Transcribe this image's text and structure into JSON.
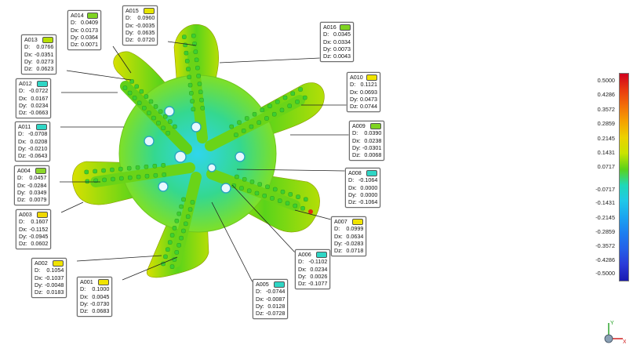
{
  "viewer": {
    "background": "#ffffff"
  },
  "callouts": [
    {
      "id": "A014",
      "swatch": "#7ed321",
      "D": "0.0409",
      "Dx": "0.0173",
      "Dy": "0.0364",
      "Dz": "0.0071"
    },
    {
      "id": "A015",
      "swatch": "#e5e500",
      "D": "0.0960",
      "Dx": "-0.0035",
      "Dy": "0.0635",
      "Dz": "0.0720"
    },
    {
      "id": "A016",
      "swatch": "#7ed321",
      "D": "0.0345",
      "Dx": "0.0334",
      "Dy": "0.0073",
      "Dz": "0.0043"
    },
    {
      "id": "A013",
      "swatch": "#b7e000",
      "D": "0.0766",
      "Dx": "-0.0351",
      "Dy": "0.0273",
      "Dz": "0.0623"
    },
    {
      "id": "A012",
      "swatch": "#2fd6c5",
      "D": "-0.0722",
      "Dx": "0.0167",
      "Dy": "0.0234",
      "Dz": "-0.0663"
    },
    {
      "id": "A010",
      "swatch": "#f0e400",
      "D": "0.1121",
      "Dx": "0.0693",
      "Dy": "0.0473",
      "Dz": "0.0744"
    },
    {
      "id": "A011",
      "swatch": "#2fd6c5",
      "D": "-0.0708",
      "Dx": "0.0208",
      "Dy": "-0.0210",
      "Dz": "-0.0643"
    },
    {
      "id": "A009",
      "swatch": "#7ed321",
      "D": "0.0390",
      "Dx": "0.0238",
      "Dy": "-0.0301",
      "Dz": "0.0068"
    },
    {
      "id": "A004",
      "swatch": "#8bd62a",
      "D": "0.0457",
      "Dx": "-0.0284",
      "Dy": "0.0349",
      "Dz": "0.0079"
    },
    {
      "id": "A008",
      "swatch": "#2fd6c5",
      "D": "-0.1064",
      "Dx": "0.0000",
      "Dy": "0.0000",
      "Dz": "-0.1064"
    },
    {
      "id": "A003",
      "swatch": "#f0d800",
      "D": "0.1607",
      "Dx": "-0.1152",
      "Dy": "-0.0945",
      "Dz": "0.0602"
    },
    {
      "id": "A007",
      "swatch": "#f0e400",
      "D": "0.0999",
      "Dx": "0.0634",
      "Dy": "-0.0283",
      "Dz": "0.0718"
    },
    {
      "id": "A006",
      "swatch": "#2fd6c5",
      "D": "-0.1102",
      "Dx": "0.0234",
      "Dy": "0.0026",
      "Dz": "-0.1077"
    },
    {
      "id": "A002",
      "swatch": "#f0e400",
      "D": "0.1054",
      "Dx": "-0.1037",
      "Dy": "-0.0048",
      "Dz": "0.0183"
    },
    {
      "id": "A001",
      "swatch": "#f0e400",
      "D": "0.1000",
      "Dx": "0.0045",
      "Dy": "-0.0730",
      "Dz": "0.0683"
    },
    {
      "id": "A005",
      "swatch": "#2fd6c5",
      "D": "-0.0744",
      "Dx": "-0.0087",
      "Dy": "0.0128",
      "Dz": "-0.0728"
    }
  ],
  "legend": {
    "labels": [
      "0.5000",
      "0.4286",
      "0.3572",
      "0.2859",
      "0.2145",
      "0.1431",
      "0.0717",
      "-0.0717",
      "-0.1431",
      "-0.2145",
      "-0.2859",
      "-0.3572",
      "-0.4286",
      "-0.5000"
    ],
    "colors": [
      "#d0001e",
      "#e83a10",
      "#f26e0a",
      "#f5a200",
      "#ecd200",
      "#c8e400",
      "#5ad21a",
      "#1fd8b8",
      "#20c8e8",
      "#1aa4f0",
      "#1c7ff0",
      "#2460e8",
      "#2a3ad8",
      "#1a1ab0"
    ]
  },
  "triad": {
    "x_label": "X",
    "y_label": "Y"
  }
}
